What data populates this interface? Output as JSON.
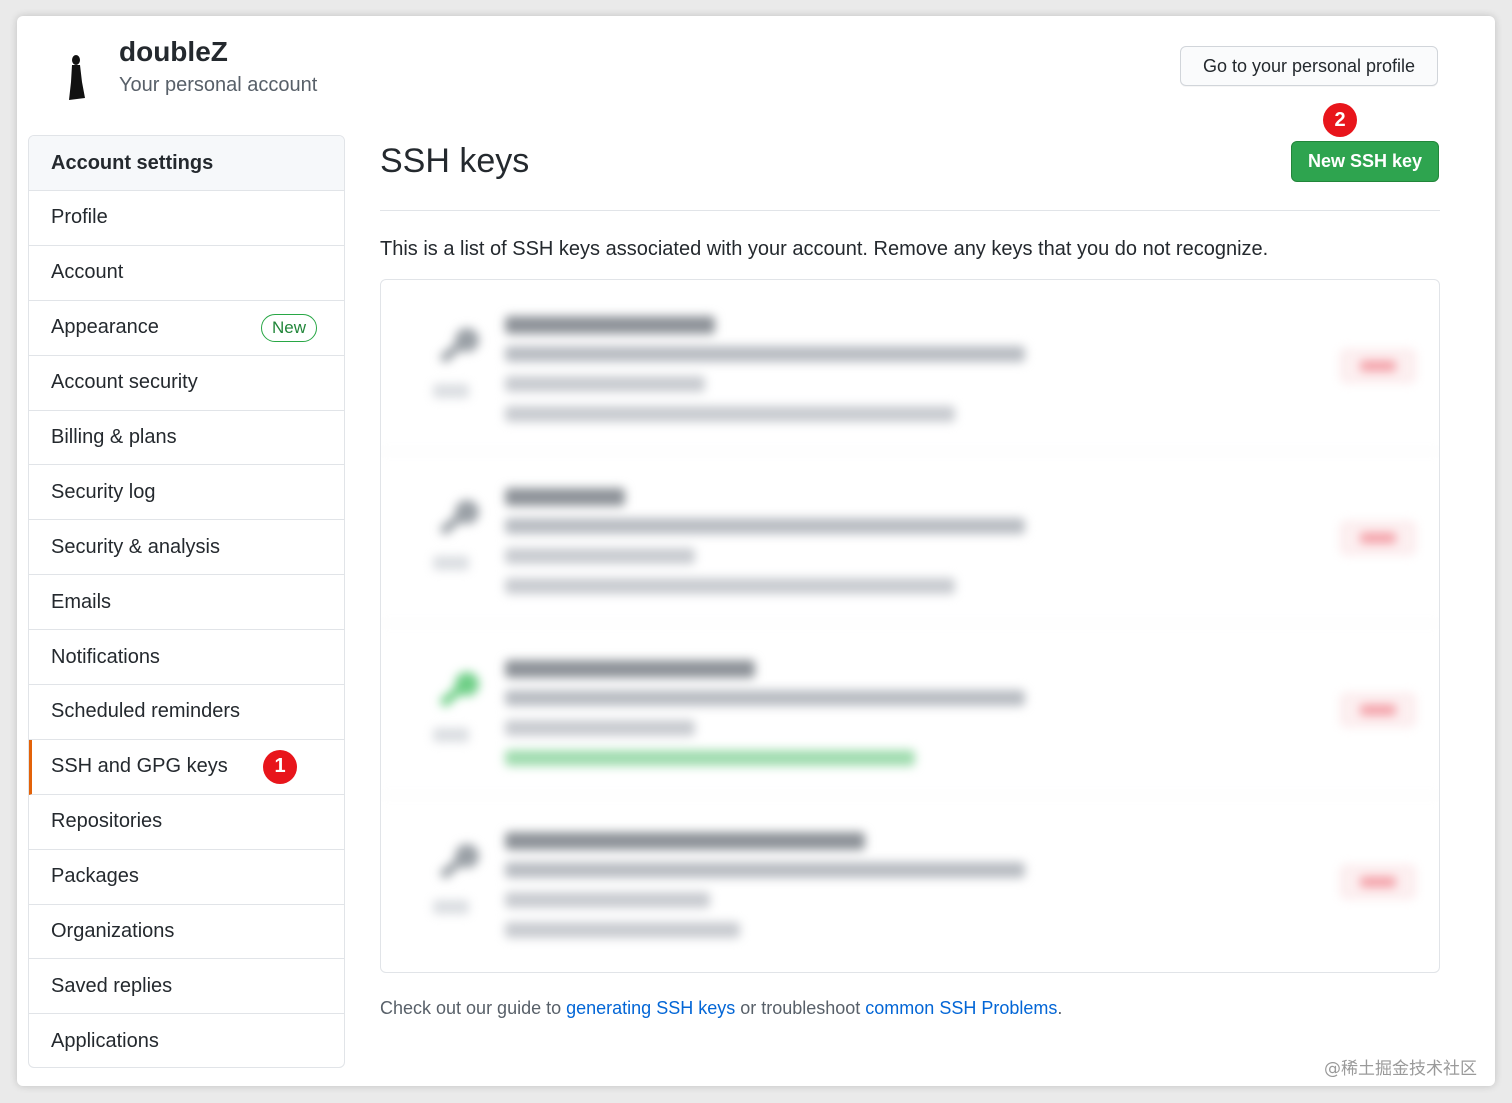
{
  "header": {
    "account_name": "doubleZ",
    "account_subtitle": "Your personal account",
    "profile_button": "Go to your personal profile"
  },
  "sidebar": {
    "heading": "Account settings",
    "items": [
      {
        "label": "Profile"
      },
      {
        "label": "Account"
      },
      {
        "label": "Appearance",
        "badge": "New"
      },
      {
        "label": "Account security"
      },
      {
        "label": "Billing & plans"
      },
      {
        "label": "Security log"
      },
      {
        "label": "Security & analysis"
      },
      {
        "label": "Emails"
      },
      {
        "label": "Notifications"
      },
      {
        "label": "Scheduled reminders"
      },
      {
        "label": "SSH and GPG keys",
        "selected": true,
        "marker": "1"
      },
      {
        "label": "Repositories"
      },
      {
        "label": "Packages"
      },
      {
        "label": "Organizations"
      },
      {
        "label": "Saved replies"
      },
      {
        "label": "Applications"
      }
    ]
  },
  "main": {
    "title": "SSH keys",
    "new_key_button": "New SSH key",
    "new_key_marker": "2",
    "intro": "This is a list of SSH keys associated with your account. Remove any keys that you do not recognize.",
    "keys_note": "Key entries are blurred in the screenshot",
    "footer": {
      "prefix": "Check out our guide to ",
      "link1": "generating SSH keys",
      "middle": " or troubleshoot ",
      "link2": "common SSH Problems",
      "suffix": "."
    }
  },
  "colors": {
    "primary_button": "#2ea44f",
    "link": "#0366d6",
    "selected_border": "#e36209",
    "marker": "#e8151b"
  },
  "watermark": "@稀土掘金技术社区"
}
